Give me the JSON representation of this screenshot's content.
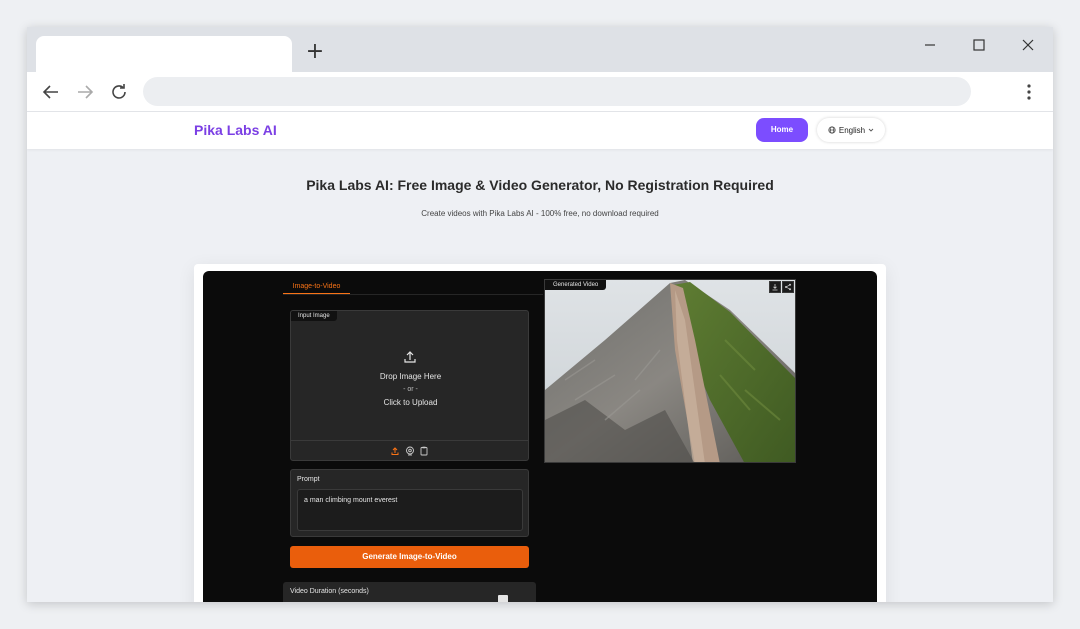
{
  "browser": {
    "tab_title": "",
    "new_tab_symbol": "+",
    "address": ""
  },
  "site": {
    "logo": "Pika Labs AI",
    "home_label": "Home",
    "language_label": "English"
  },
  "hero": {
    "title": "Pika Labs AI: Free Image & Video Generator, No Registration Required",
    "subtitle": "Create videos with Pika Labs AI - 100% free, no download required"
  },
  "app": {
    "tab_label": "Image-to-Video",
    "input_image_label": "Input Image",
    "drop_line1": "Drop Image Here",
    "drop_line2": "- or -",
    "drop_line3": "Click to Upload",
    "prompt_label": "Prompt",
    "prompt_value": "a man climbing mount everest",
    "generate_label": "Generate Image-to-Video",
    "duration_label": "Video Duration (seconds)",
    "generated_video_label": "Generated Video"
  },
  "colors": {
    "brand": "#7b3fe4",
    "home_button": "#7c4dff",
    "accent_orange": "#ea5e0c",
    "app_background": "#0b0b0b"
  }
}
